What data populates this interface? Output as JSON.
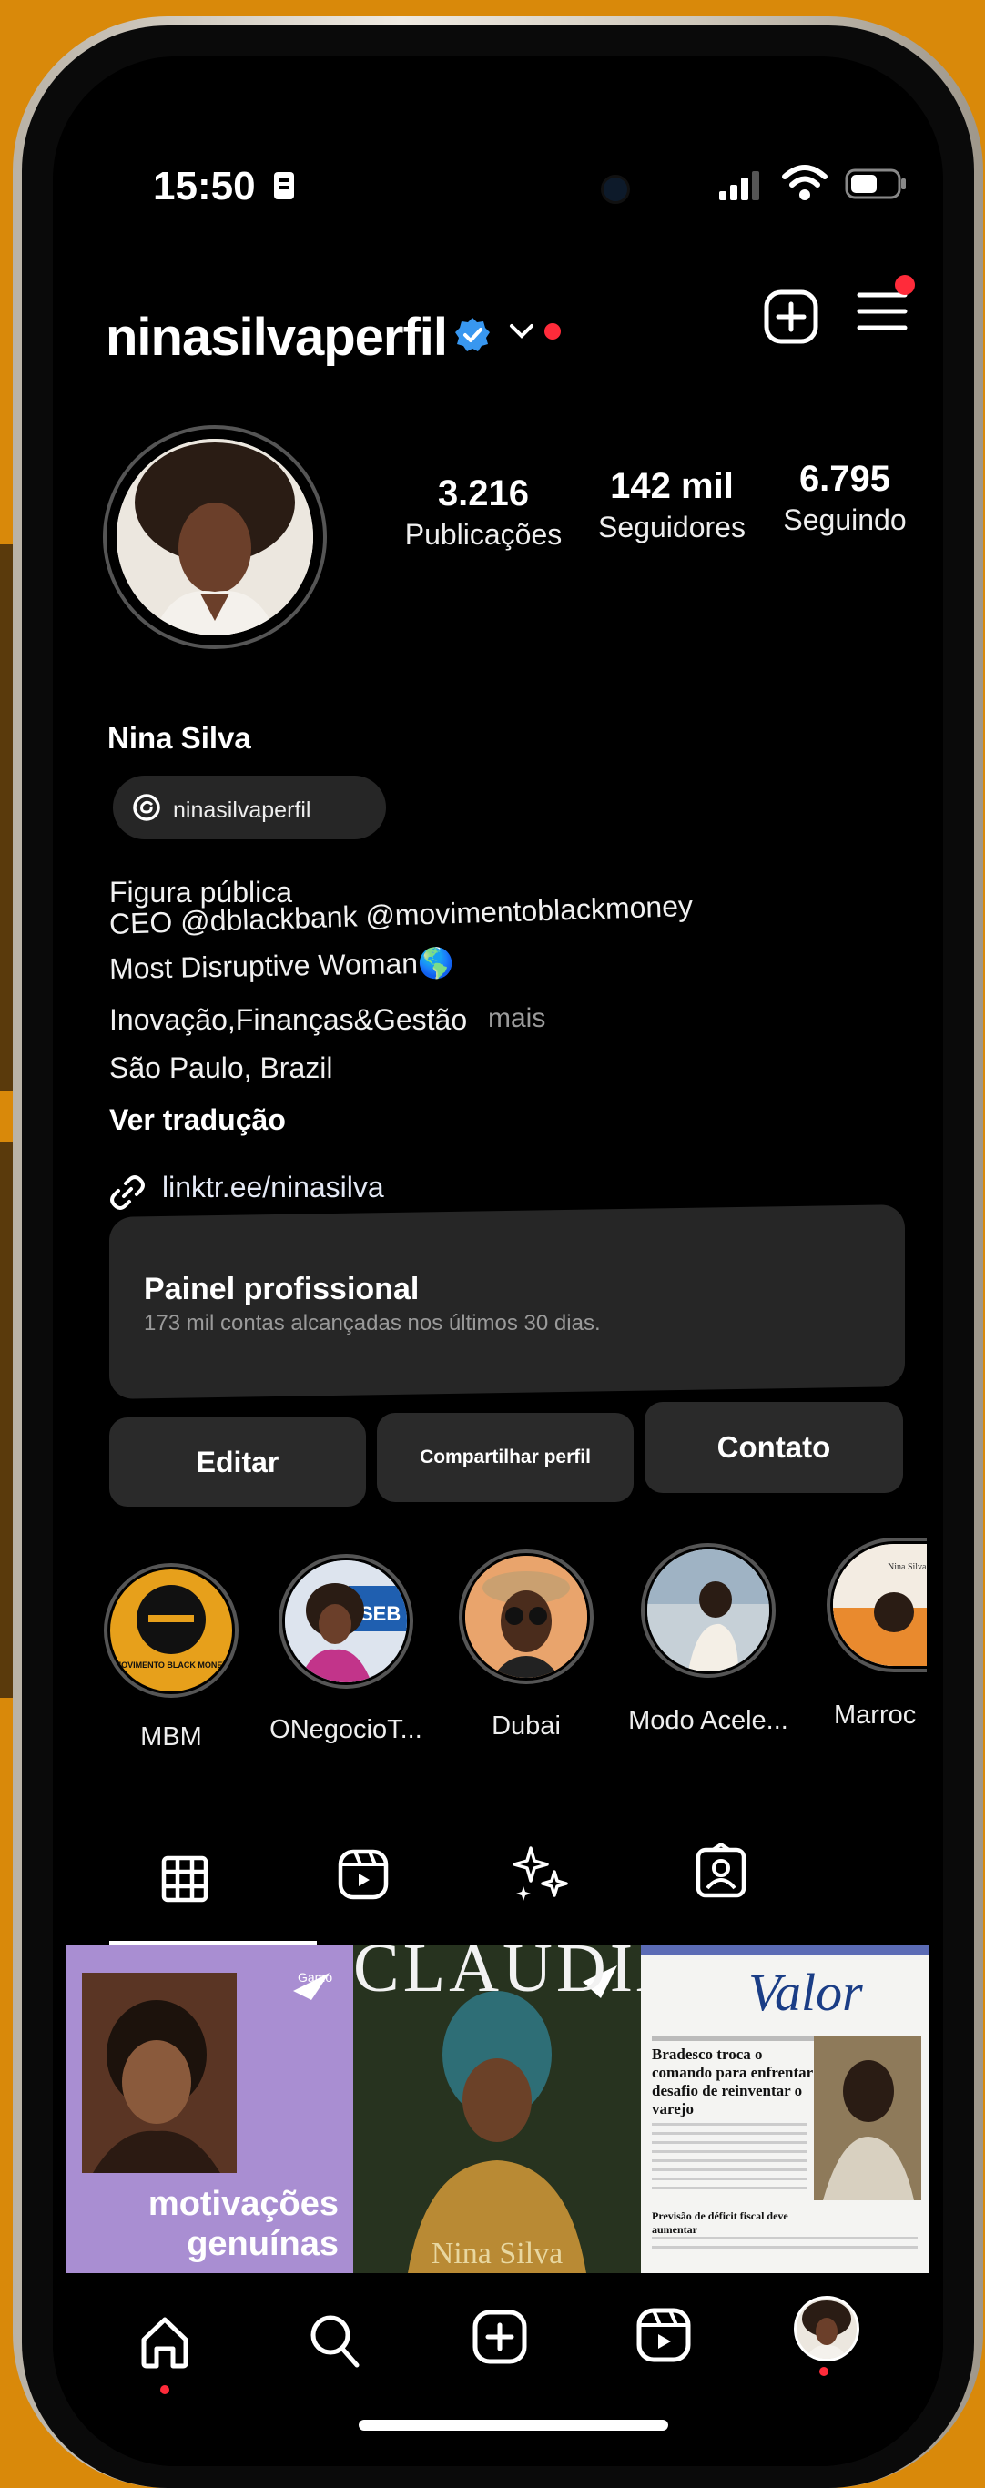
{
  "status_bar": {
    "time": "15:50"
  },
  "header": {
    "username": "ninasilvaperfil"
  },
  "stats": [
    {
      "value": "3.216",
      "label": "Publicações"
    },
    {
      "value": "142 mil",
      "label": "Seguidores"
    },
    {
      "value": "6.795",
      "label": "Seguindo"
    }
  ],
  "profile": {
    "name": "Nina Silva",
    "threads_handle": "ninasilvaperfil",
    "bio": [
      "Figura pública",
      "CEO @dblackbank @movimentoblackmoney",
      "Most Disruptive Woman🌎",
      "Inovação,Finanças&Gestão",
      "São Paulo, Brazil"
    ],
    "more_label": "mais",
    "translate_label": "Ver tradução",
    "link": "linktr.ee/ninasilva"
  },
  "panel": {
    "title": "Painel profissional",
    "subtitle": "173 mil contas alcançadas nos últimos 30 dias."
  },
  "buttons": {
    "edit": "Editar",
    "share": "Compartilhar perfil",
    "contact": "Contato"
  },
  "highlights": [
    {
      "label": "MBM",
      "badge": "MOVIMENTO BLACK MONEY"
    },
    {
      "label": "ONegocioT...",
      "badge": "SEB"
    },
    {
      "label": "Dubai"
    },
    {
      "label": "Modo Acele..."
    },
    {
      "label": "Marroc",
      "badge": "Nina Silva"
    }
  ],
  "posts": [
    {
      "caption": "motivações genuínas",
      "corner": "Gamo"
    },
    {
      "caption": "CLAUDIA",
      "subcaption": "Nina Silva"
    },
    {
      "caption": "Valor",
      "headline": "Bradesco troca o comando para enfrentar desafio de reinventar o varejo",
      "subheadline": "Previsão de déficit fiscal deve aumentar"
    }
  ],
  "colors": {
    "background": "#D9890A",
    "accent_red": "#ff2b3a",
    "verified_blue": "#3897f0",
    "panel_bg": "#262626"
  }
}
